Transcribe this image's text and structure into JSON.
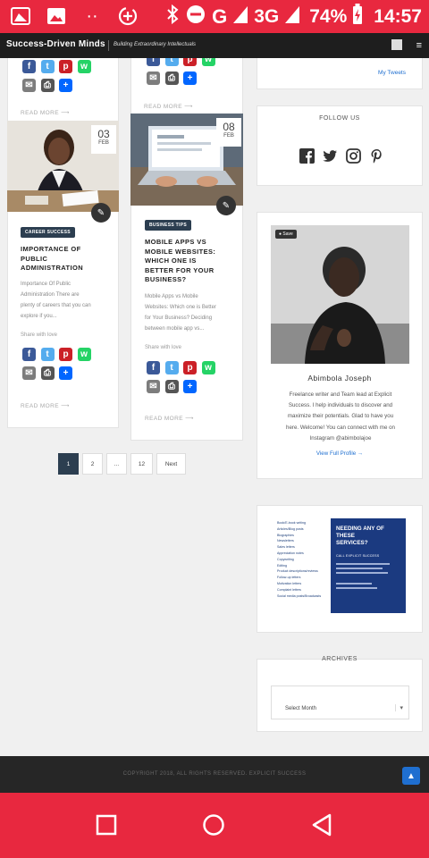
{
  "status_bar": {
    "battery": "74%",
    "time": "14:57",
    "network": "3G"
  },
  "header": {
    "brand": "Success-Driven Minds",
    "tagline": "Building Extraordinary Intellectuals"
  },
  "posts": [
    {
      "date_day": "03",
      "date_month": "FEB",
      "category": "CAREER SUCCESS",
      "title_lines": [
        "IMPORTANCE OF",
        "PUBLIC",
        "ADMINISTRATION"
      ],
      "excerpt_lines": [
        "Importance Of Public",
        "Administration There are",
        "plenty of careers that you can",
        "explore if you..."
      ],
      "share_label": "Share with love",
      "read_more": "READ MORE"
    },
    {
      "date_day": "08",
      "date_month": "FEB",
      "category": "BUSINESS TIPS",
      "title_lines": [
        "MOBILE APPS VS",
        "MOBILE WEBSITES:",
        "WHICH ONE IS",
        "BETTER FOR YOUR",
        "BUSINESS?"
      ],
      "excerpt_lines": [
        "Mobile Apps vs Mobile",
        "Websites: Which one is Better",
        "for Your Business? Deciding",
        "between mobile app vs..."
      ],
      "share_label": "Share with love",
      "read_more": "READ MORE"
    }
  ],
  "top_read_more": "READ MORE",
  "pagination": {
    "pages": [
      "1",
      "2",
      "...",
      "12"
    ],
    "next": "Next",
    "current": "1"
  },
  "sidebar": {
    "tweets_link": "My Tweets",
    "follow_title": "FOLLOW US",
    "social": [
      "facebook-icon",
      "twitter-icon",
      "instagram-icon",
      "pinterest-icon"
    ],
    "profile": {
      "save_label": "Save",
      "name": "Abimbola Joseph",
      "bio_lines": [
        "Freelance writer and Team lead at Explicit",
        "Success. I help individuals to discover and",
        "maximize their potentials. Glad to have you",
        "here. Welcome! You can connect with me on",
        "Instagram @abimbolajoe"
      ],
      "view_profile": "View Full Profile →"
    },
    "ad": {
      "heading_lines": [
        "NEEDING ANY OF",
        "THESE",
        "SERVICES?"
      ],
      "cta": "CALL EXPLICIT SUCCESS",
      "services": [
        "Book/E-book writing",
        "Articles/Blog posts",
        "Biographies",
        "Newsletters",
        "Sales letters",
        "Appreciation notes",
        "Copywriting",
        "Editing",
        "Product descriptions/reviews",
        "Follow-up letters",
        "Motivation letters",
        "Complaint letters",
        "Social media posts/Broadcasts"
      ]
    },
    "archives_title": "ARCHIVES",
    "archives_select": "Select Month"
  },
  "footer": {
    "copyright": "COPYRIGHT 2018, ALL RIGHTS RESERVED. EXPLICIT SUCCESS"
  },
  "colors": {
    "accent_red": "#e8283f",
    "nav_dark": "#1e1e1e",
    "category_bg": "#2c3e50",
    "facebook": "#3b5998",
    "twitter": "#55acee",
    "pinterest": "#cb2027",
    "whatsapp": "#25d366",
    "email": "#7d7d7d",
    "print": "#555555",
    "share": "#0166ff"
  }
}
